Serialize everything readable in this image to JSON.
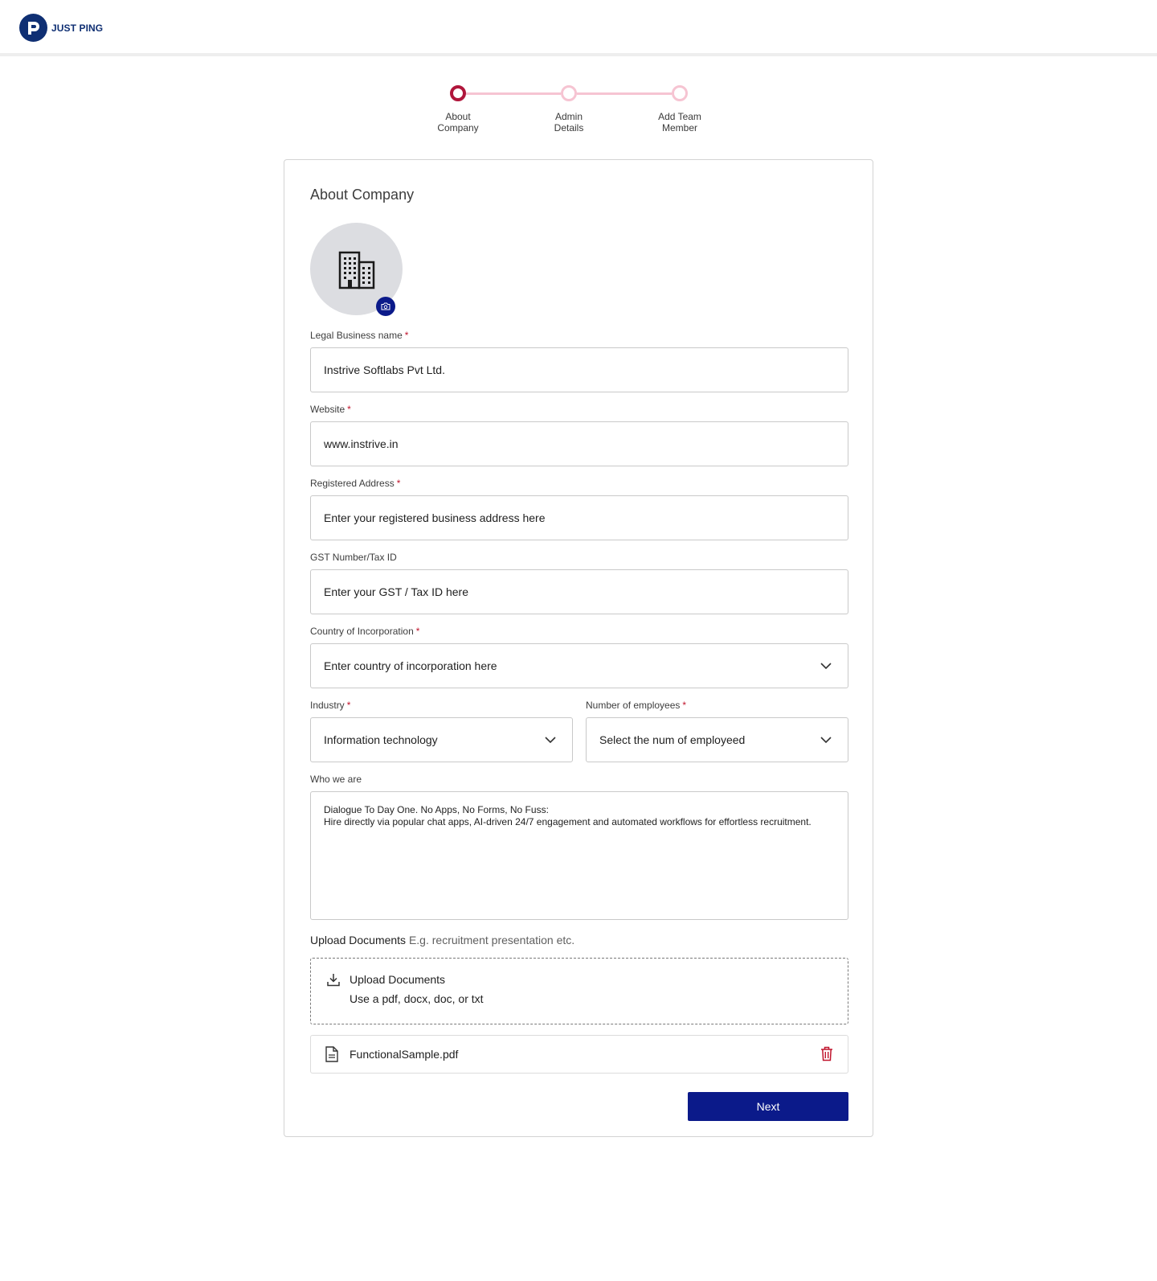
{
  "brand": {
    "name": "JUST PING",
    "logo_letter": "P",
    "color": "#0f2f73"
  },
  "stepper": {
    "active_color": "#b0163b",
    "inactive_color": "#f6c4d2",
    "steps": [
      {
        "label_line1": "About",
        "label_line2": "Company",
        "state": "active"
      },
      {
        "label_line1": "Admin",
        "label_line2": "Details",
        "state": "inactive"
      },
      {
        "label_line1": "Add Team",
        "label_line2": "Member",
        "state": "inactive"
      }
    ]
  },
  "form": {
    "title": "About Company",
    "required_mark": "*",
    "avatar_icon": "building-icon",
    "avatar_badge_icon": "camera-icon",
    "legal_name": {
      "label": "Legal Business name",
      "value": "Instrive Softlabs Pvt Ltd."
    },
    "website": {
      "label": "Website",
      "value": "www.instrive.in"
    },
    "address": {
      "label": "Registered Address",
      "placeholder": "Enter your registered business address here"
    },
    "gst": {
      "label": "GST Number/Tax ID",
      "placeholder": "Enter your GST / Tax ID here"
    },
    "country": {
      "label": "Country of Incorporation",
      "placeholder": "Enter country of incorporation here"
    },
    "industry": {
      "label": "Industry",
      "value": "Information technology"
    },
    "employees": {
      "label": "Number of employees",
      "placeholder": "Select the num of employeed"
    },
    "about": {
      "label": "Who we are",
      "line1": "Dialogue To Day One. No Apps, No Forms, No Fuss:",
      "line2": "Hire directly via popular chat apps, AI-driven 24/7 engagement and automated workflows for effortless recruitment."
    },
    "upload": {
      "heading": "Upload Documents",
      "hint": "E.g. recruitment presentation etc.",
      "dropzone_title": "Upload Documents",
      "dropzone_sub": "Use a pdf, docx, doc, or txt"
    },
    "file": {
      "name": "FunctionalSample.pdf"
    },
    "next_label": "Next",
    "button_color": "#0b1a8a",
    "delete_color": "#c0152d"
  }
}
